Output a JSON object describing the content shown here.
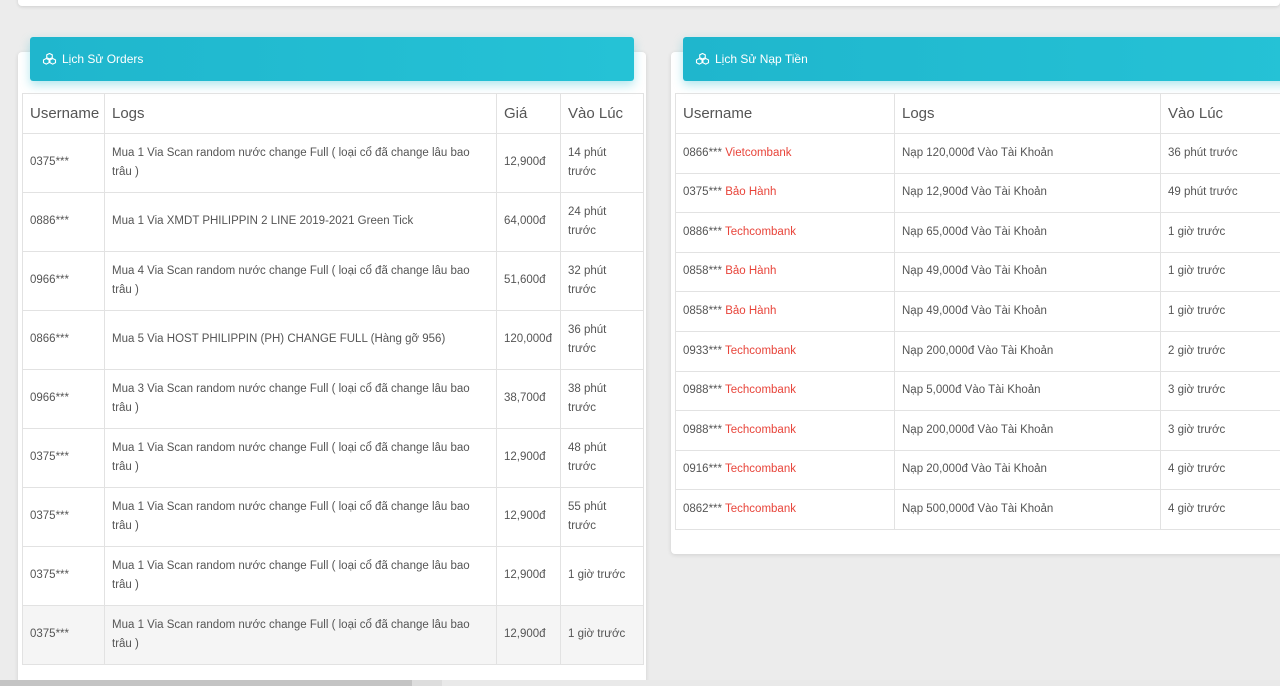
{
  "orders": {
    "title": "Lịch Sử Orders",
    "columns": [
      "Username",
      "Logs",
      "Giá",
      "Vào Lúc"
    ],
    "rows": [
      {
        "user": "0375***",
        "log": "Mua 1 Via Scan random nước change Full ( loại cổ đã change lâu bao trâu )",
        "price": "12,900đ",
        "time": "14 phút trước"
      },
      {
        "user": "0886***",
        "log": "Mua 1 Via XMDT PHILIPPIN 2 LINE 2019-2021 Green Tick",
        "price": "64,000đ",
        "time": "24 phút trước"
      },
      {
        "user": "0966***",
        "log": "Mua 4 Via Scan random nước change Full ( loại cổ đã change lâu bao trâu )",
        "price": "51,600đ",
        "time": "32 phút trước"
      },
      {
        "user": "0866***",
        "log": "Mua 5 Via HOST PHILIPPIN (PH) CHANGE FULL (Hàng gỡ 956)",
        "price": "120,000đ",
        "time": "36 phút trước"
      },
      {
        "user": "0966***",
        "log": "Mua 3 Via Scan random nước change Full ( loại cổ đã change lâu bao trâu )",
        "price": "38,700đ",
        "time": "38 phút trước"
      },
      {
        "user": "0375***",
        "log": "Mua 1 Via Scan random nước change Full ( loại cổ đã change lâu bao trâu )",
        "price": "12,900đ",
        "time": "48 phút trước"
      },
      {
        "user": "0375***",
        "log": "Mua 1 Via Scan random nước change Full ( loại cổ đã change lâu bao trâu )",
        "price": "12,900đ",
        "time": "55 phút trước"
      },
      {
        "user": "0375***",
        "log": "Mua 1 Via Scan random nước change Full ( loại cổ đã change lâu bao trâu )",
        "price": "12,900đ",
        "time": "1 giờ trước"
      },
      {
        "user": "0375***",
        "log": "Mua 1 Via Scan random nước change Full ( loại cổ đã change lâu bao trâu )",
        "price": "12,900đ",
        "time": "1 giờ trước"
      }
    ]
  },
  "deposits": {
    "title": "Lịch Sử Nạp Tiền",
    "columns": [
      "Username",
      "Logs",
      "Vào Lúc"
    ],
    "rows": [
      {
        "user": "0866***",
        "bank": "Vietcombank",
        "log": "Nạp 120,000đ Vào Tài Khoản",
        "time": "36 phút trước"
      },
      {
        "user": "0375***",
        "bank": "Bảo Hành",
        "log": "Nạp 12,900đ Vào Tài Khoản",
        "time": "49 phút trước"
      },
      {
        "user": "0886***",
        "bank": "Techcombank",
        "log": "Nạp 65,000đ Vào Tài Khoản",
        "time": "1 giờ trước"
      },
      {
        "user": "0858***",
        "bank": "Bảo Hành",
        "log": "Nạp 49,000đ Vào Tài Khoản",
        "time": "1 giờ trước"
      },
      {
        "user": "0858***",
        "bank": "Bảo Hành",
        "log": "Nạp 49,000đ Vào Tài Khoản",
        "time": "1 giờ trước"
      },
      {
        "user": "0933***",
        "bank": "Techcombank",
        "log": "Nạp 200,000đ Vào Tài Khoản",
        "time": "2 giờ trước"
      },
      {
        "user": "0988***",
        "bank": "Techcombank",
        "log": "Nạp 5,000đ Vào Tài Khoản",
        "time": "3 giờ trước"
      },
      {
        "user": "0988***",
        "bank": "Techcombank",
        "log": "Nạp 200,000đ Vào Tài Khoản",
        "time": "3 giờ trước"
      },
      {
        "user": "0916***",
        "bank": "Techcombank",
        "log": "Nạp 20,000đ Vào Tài Khoản",
        "time": "4 giờ trước"
      },
      {
        "user": "0862***",
        "bank": "Techcombank",
        "log": "Nạp 500,000đ Vào Tài Khoản",
        "time": "4 giờ trước"
      }
    ]
  },
  "icons": {
    "header": "cubes-icon"
  },
  "colors": {
    "header": "#1fb6cd",
    "bank": "#e8443a"
  }
}
